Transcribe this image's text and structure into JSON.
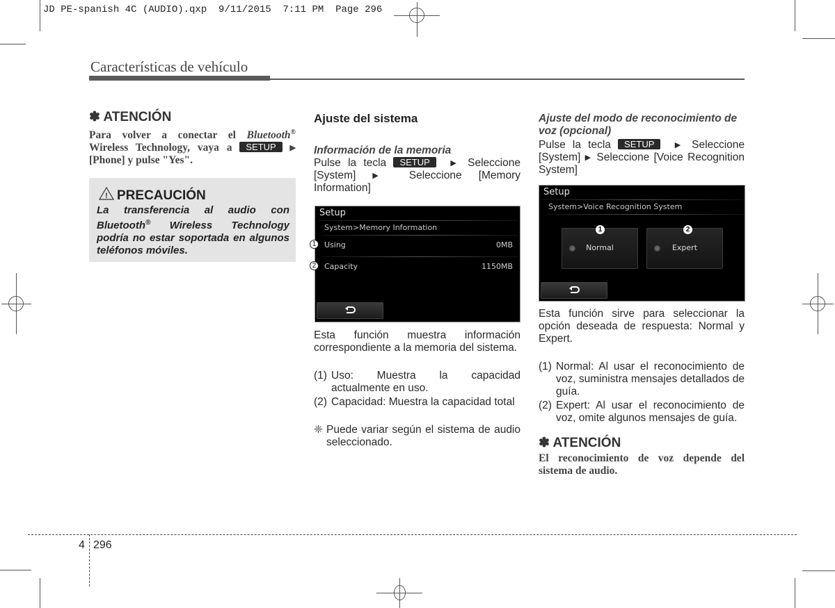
{
  "slug": "JD PE-spanish 4C (AUDIO).qxp  9/11/2015  7:11 PM  Page 296",
  "section_title": "Características de vehículo",
  "setup_key_label": "SETUP",
  "arrow_glyph": "▶",
  "left_column": {
    "attention": {
      "heading": "✽ ATENCIÓN",
      "text_before": "Para volver a conectar el ",
      "text_italic": "Bluetooth",
      "reg_mark": "®",
      "text_middle": " Wireless Technology, vaya a ",
      "text_after": " [Phone] y pulse \"Yes\"."
    },
    "caution": {
      "icon": "warning-triangle-icon",
      "heading": "PRECAUCIÓN",
      "text_1": "La transferencia al audio con Bluetooth",
      "reg_mark": "®",
      "text_2": " Wireless Technology podría no estar soportada en algunos teléfonos móviles."
    }
  },
  "middle_column": {
    "heading": "Ajuste del sistema",
    "subheading": "Información de la memoria",
    "instr_1": "Pulse la tecla ",
    "instr_2": " Seleccione [System] ",
    "instr_3": " Seleccione [Memory Information]",
    "screen": {
      "title": "Setup",
      "breadcrumb": "System>Memory Information",
      "rows": [
        {
          "callout": "1",
          "label": "Using",
          "value": "0MB"
        },
        {
          "callout": "2",
          "label": "Capacity",
          "value": "1150MB"
        }
      ],
      "back_icon": "back-arrow-icon",
      "back_glyph": "⮌"
    },
    "description": "Esta función muestra información correspondiente a la memoria del sistema.",
    "list": [
      {
        "num": "(1)",
        "text": "Uso: Muestra la capacidad actualmente en uso."
      },
      {
        "num": "(2)",
        "text": "Capacidad: Muestra la capacidad total"
      }
    ],
    "note_mark": "❈",
    "note": "Puede variar según el sistema de audio seleccionado."
  },
  "right_column": {
    "subheading": "Ajuste del modo de reconocimiento de voz (opcional)",
    "instr_1": "Pulse la tecla ",
    "instr_2": " Seleccione [System] ",
    "instr_3": " Seleccione [Voice Recognition System]",
    "screen": {
      "title": "Setup",
      "breadcrumb": "System>Voice Recognition System",
      "options": [
        {
          "callout": "1",
          "label": "Normal"
        },
        {
          "callout": "2",
          "label": "Expert"
        }
      ],
      "back_glyph": "⮌"
    },
    "description": "Esta función sirve para seleccionar la opción deseada de respuesta: Normal y Expert.",
    "list": [
      {
        "num": "(1)",
        "text": "Normal: Al usar el reconocimiento de voz, suministra mensajes detallados de guía."
      },
      {
        "num": "(2)",
        "text": "Expert: Al usar el reconocimiento de voz, omite algunos mensajes de guía."
      }
    ],
    "attention": {
      "heading": "✽ ATENCIÓN",
      "text": "El reconocimiento de voz depende del sistema de audio."
    }
  },
  "footer": {
    "chapter": "4",
    "page": "296"
  }
}
